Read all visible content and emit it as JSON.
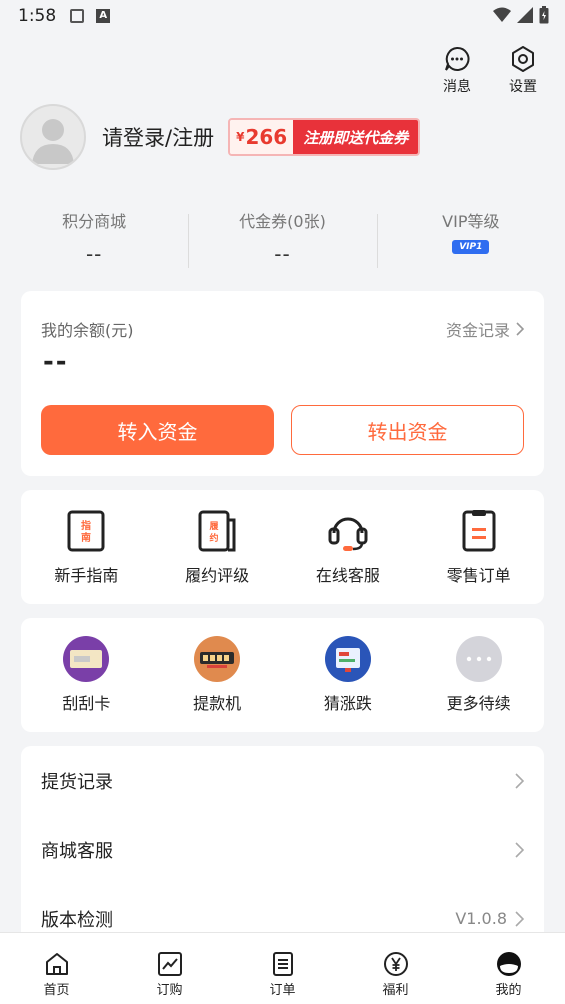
{
  "status_bar": {
    "time": "1:58"
  },
  "top_actions": {
    "messages_label": "消息",
    "settings_label": "设置"
  },
  "profile": {
    "login_text": "请登录/注册",
    "promo_currency": "¥",
    "promo_amount": "266",
    "promo_text": "注册即送代金券"
  },
  "stats": [
    {
      "label": "积分商城",
      "value": "--"
    },
    {
      "label": "代金券(0张)",
      "value": "--"
    },
    {
      "label": "VIP等级",
      "badge": "VIP1"
    }
  ],
  "balance": {
    "label": "我的余额(元)",
    "record_link": "资金记录",
    "value": "--",
    "deposit_button": "转入资金",
    "withdraw_button": "转出资金"
  },
  "services": [
    {
      "label": "新手指南",
      "icon": "guide-icon"
    },
    {
      "label": "履约评级",
      "icon": "rating-icon"
    },
    {
      "label": "在线客服",
      "icon": "headset-icon"
    },
    {
      "label": "零售订单",
      "icon": "order-clipboard-icon"
    }
  ],
  "activities": [
    {
      "label": "刮刮卡",
      "icon": "scratch-card-icon"
    },
    {
      "label": "提款机",
      "icon": "atm-icon"
    },
    {
      "label": "猜涨跌",
      "icon": "guess-icon"
    },
    {
      "label": "更多待续",
      "icon": "more-icon"
    }
  ],
  "menu": [
    {
      "label": "提货记录",
      "value": ""
    },
    {
      "label": "商城客服",
      "value": ""
    },
    {
      "label": "版本检测",
      "value": "V1.0.8"
    }
  ],
  "tabs": [
    {
      "label": "首页",
      "icon": "home-icon"
    },
    {
      "label": "订购",
      "icon": "trend-icon"
    },
    {
      "label": "订单",
      "icon": "list-icon"
    },
    {
      "label": "福利",
      "icon": "yen-icon"
    },
    {
      "label": "我的",
      "icon": "profile-icon",
      "active": true
    }
  ]
}
